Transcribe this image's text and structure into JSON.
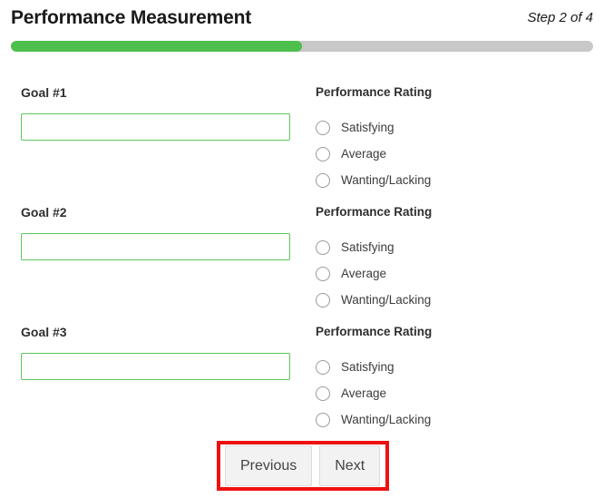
{
  "header": {
    "title": "Performance Measurement",
    "step_indicator": "Step 2 of 4"
  },
  "progress": {
    "percent": 50,
    "fill_color": "#4cbf4c",
    "track_color": "#c8c8c8"
  },
  "form": {
    "goals": [
      {
        "label": "Goal #1",
        "value": "",
        "placeholder": "",
        "rating_title": "Performance Rating",
        "options": [
          "Satisfying",
          "Average",
          "Wanting/Lacking"
        ],
        "selected": null
      },
      {
        "label": "Goal #2",
        "value": "",
        "placeholder": "",
        "rating_title": "Performance Rating",
        "options": [
          "Satisfying",
          "Average",
          "Wanting/Lacking"
        ],
        "selected": null
      },
      {
        "label": "Goal #3",
        "value": "",
        "placeholder": "",
        "rating_title": "Performance Rating",
        "options": [
          "Satisfying",
          "Average",
          "Wanting/Lacking"
        ],
        "selected": null
      }
    ]
  },
  "footer": {
    "previous_label": "Previous",
    "next_label": "Next",
    "highlight_color": "#ee1111"
  }
}
